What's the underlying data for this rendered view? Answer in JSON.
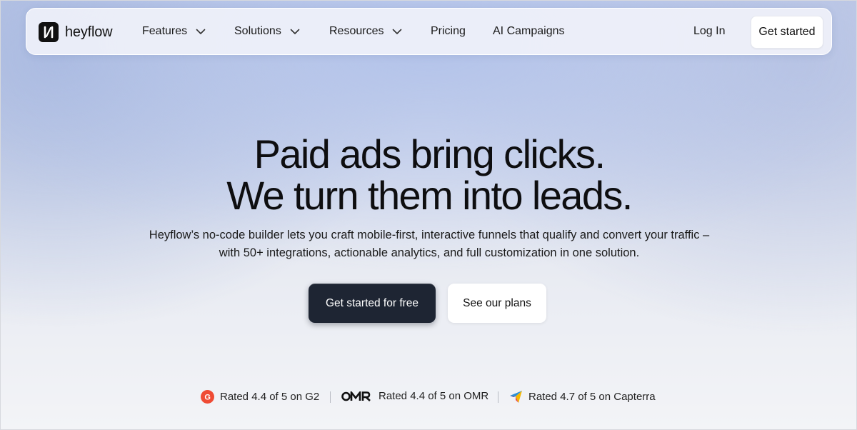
{
  "brand": {
    "name": "heyflow",
    "logo_icon": "heyflow-logo-icon"
  },
  "nav": {
    "items": [
      {
        "label": "Features",
        "has_dropdown": true
      },
      {
        "label": "Solutions",
        "has_dropdown": true
      },
      {
        "label": "Resources",
        "has_dropdown": true
      },
      {
        "label": "Pricing",
        "has_dropdown": false
      },
      {
        "label": "AI Campaigns",
        "has_dropdown": false
      }
    ],
    "login_label": "Log In",
    "cta_label": "Get started"
  },
  "hero": {
    "headline_line1": "Paid ads bring clicks.",
    "headline_line2": "We turn them into leads.",
    "subtext_line1": "Heyflow’s no-code builder lets you craft mobile-first, interactive funnels that qualify and convert your traffic –",
    "subtext_line2": "with 50+ integrations, actionable analytics, and full customization in one solution.",
    "primary_button": "Get started for free",
    "secondary_button": "See our plans"
  },
  "ratings": [
    {
      "text": "Rated 4.4 of 5 on G2",
      "icon": "g2-icon"
    },
    {
      "text": "Rated 4.4 of 5 on OMR",
      "icon": "omr-logo-icon"
    },
    {
      "text": "Rated 4.7 of 5 on Capterra",
      "icon": "capterra-icon"
    }
  ],
  "colors": {
    "primary_button_bg": "#1e2533",
    "g2_red": "#ef4b34",
    "capterra_blue": "#2c8fd6",
    "capterra_yellow": "#f5b800",
    "capterra_red": "#e5484d"
  }
}
